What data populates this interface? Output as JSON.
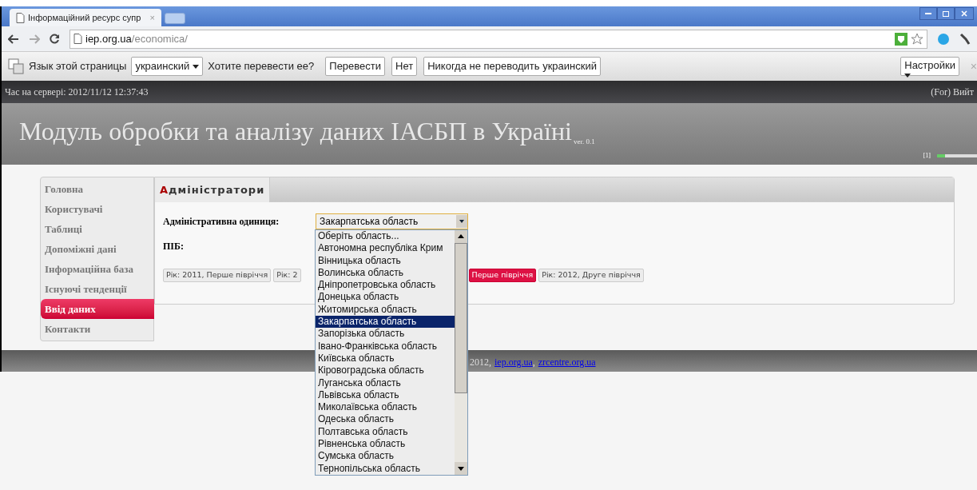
{
  "browser": {
    "tab_title": "Інформаційний ресурс супр",
    "tab_close": "×",
    "url_host": "iep.org.ua",
    "url_path": "/economica/"
  },
  "translate_bar": {
    "label": "Язык этой страницы",
    "language": "украинский",
    "question": "Хотите перевести ее?",
    "buttons": [
      "Перевести",
      "Нет",
      "Никогда не переводить украинский"
    ],
    "settings": "Настройки",
    "close": "×"
  },
  "server_bar": {
    "time": "Час на сервері: 2012/11/12 12:37:43",
    "user": "(For) Вийт"
  },
  "header": {
    "title": "Модуль обробки та аналізу даних ІАСБП в Україні",
    "version": "ver. 0.1",
    "page_marker": "[1]"
  },
  "sidebar": {
    "items": [
      {
        "label": "Головна",
        "selected": false
      },
      {
        "label": "Користувачі",
        "selected": false
      },
      {
        "label": "Таблиці",
        "selected": false
      },
      {
        "label": "Допоміжні дані",
        "selected": false
      },
      {
        "label": "Інформаційна база",
        "selected": false
      },
      {
        "label": "Існуючі тенденції",
        "selected": false
      },
      {
        "label": "Ввід даних",
        "selected": true
      },
      {
        "label": "Контакти",
        "selected": false
      }
    ]
  },
  "panel": {
    "tab": "Адміністратори",
    "unit_label": "Адміністративна одиниця:",
    "unit_value": "Закарпатська область",
    "name_label": "ПІБ:",
    "periods": [
      {
        "label": "Рік: 2011, Перше півріччя",
        "selected": false
      },
      {
        "label": "Рік: 2",
        "selected": false
      },
      {
        "label": "Перше півріччя",
        "selected": true
      },
      {
        "label": "Рік: 2012, Друге півріччя",
        "selected": false
      }
    ]
  },
  "dropdown": {
    "options": [
      {
        "label": "Оберіть область...",
        "selected": false
      },
      {
        "label": "Автономна республіка Крим",
        "selected": false
      },
      {
        "label": "Вінницька область",
        "selected": false
      },
      {
        "label": "Волинська область",
        "selected": false
      },
      {
        "label": "Дніпропетровська область",
        "selected": false
      },
      {
        "label": "Донецька область",
        "selected": false
      },
      {
        "label": "Житомирська область",
        "selected": false
      },
      {
        "label": "Закарпатська область",
        "selected": true
      },
      {
        "label": "Запорізька область",
        "selected": false
      },
      {
        "label": "Івано-Франківська область",
        "selected": false
      },
      {
        "label": "Київська область",
        "selected": false
      },
      {
        "label": "Кіровоградська область",
        "selected": false
      },
      {
        "label": "Луганська область",
        "selected": false
      },
      {
        "label": "Львівська область",
        "selected": false
      },
      {
        "label": "Миколаївська область",
        "selected": false
      },
      {
        "label": "Одеська область",
        "selected": false
      },
      {
        "label": "Полтавська область",
        "selected": false
      },
      {
        "label": "Рівненська область",
        "selected": false
      },
      {
        "label": "Сумська область",
        "selected": false
      },
      {
        "label": "Тернопільська область",
        "selected": false
      }
    ]
  },
  "footer": {
    "text": "2012,",
    "links": [
      "iep.org.ua",
      "zrcentre.org.ua"
    ],
    "separator": ","
  }
}
